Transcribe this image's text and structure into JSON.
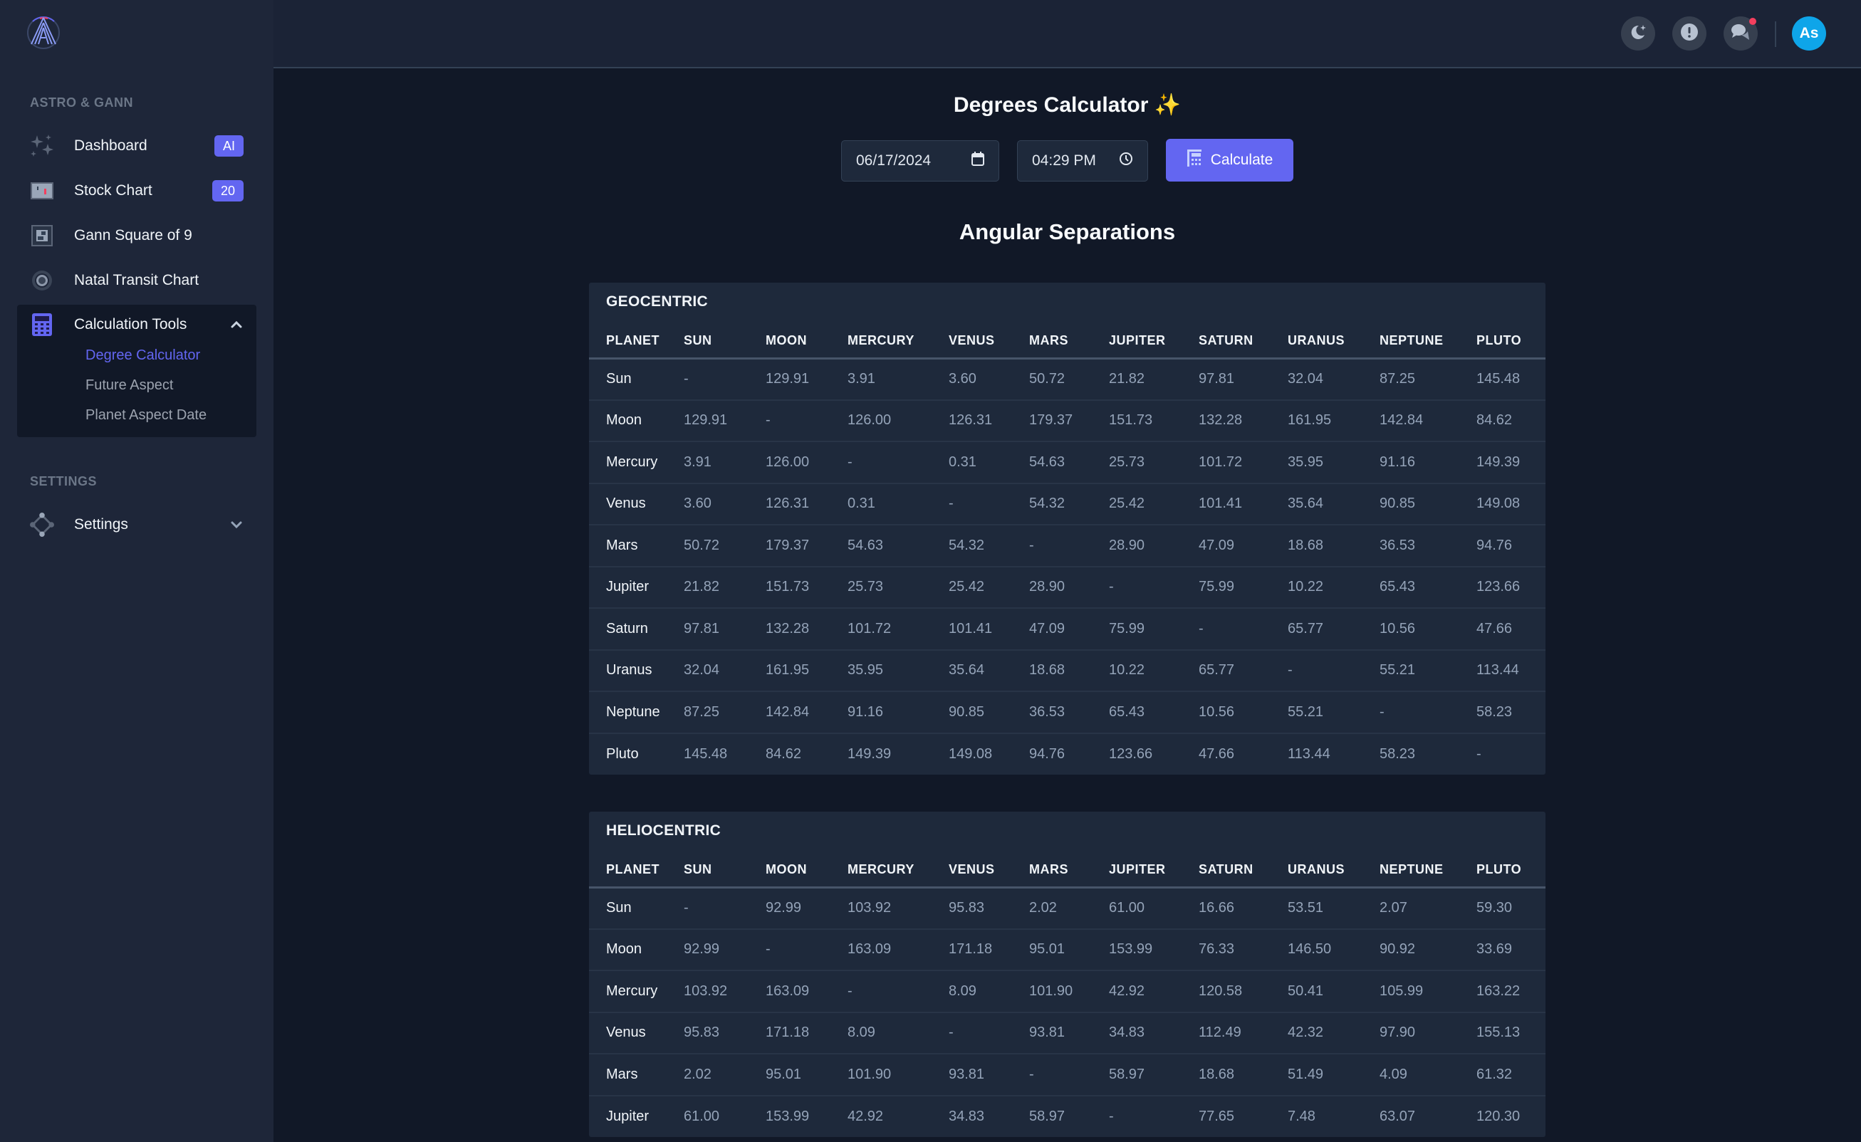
{
  "sidebar": {
    "logo_name": "astro-gann-logo",
    "sections": [
      {
        "label": "ASTRO & GANN"
      },
      {
        "label": "SETTINGS"
      }
    ],
    "items": [
      {
        "label": "Dashboard",
        "badge": "AI",
        "icon": "sparkles-icon"
      },
      {
        "label": "Stock Chart",
        "badge": "20",
        "icon": "stock-chart-icon"
      },
      {
        "label": "Gann Square of 9",
        "icon": "square-grid-icon"
      },
      {
        "label": "Natal Transit Chart",
        "icon": "target-circle-icon"
      },
      {
        "label": "Calculation Tools",
        "icon": "calculator-icon",
        "expanded": true,
        "children": [
          {
            "label": "Degree Calculator",
            "active": true
          },
          {
            "label": "Future Aspect"
          },
          {
            "label": "Planet Aspect Date"
          }
        ]
      }
    ],
    "settings": {
      "label": "Settings",
      "icon": "nodes-diamond-icon",
      "expanded": false
    }
  },
  "header": {
    "buttons": [
      "moon-theme-icon",
      "alert-icon",
      "chat-icon"
    ],
    "chat_has_notification": true,
    "avatar_initials": "As"
  },
  "main": {
    "title": "Degrees Calculator ✨",
    "date_value": "06/17/2024",
    "time_value": "04:29 PM",
    "calculate_label": "Calculate",
    "section_title": "Angular Separations",
    "columns": [
      "PLANET",
      "SUN",
      "MOON",
      "MERCURY",
      "VENUS",
      "MARS",
      "JUPITER",
      "SATURN",
      "URANUS",
      "NEPTUNE",
      "PLUTO"
    ],
    "tables": [
      {
        "title": "GEOCENTRIC",
        "rows": [
          [
            "Sun",
            "-",
            "129.91",
            "3.91",
            "3.60",
            "50.72",
            "21.82",
            "97.81",
            "32.04",
            "87.25",
            "145.48"
          ],
          [
            "Moon",
            "129.91",
            "-",
            "126.00",
            "126.31",
            "179.37",
            "151.73",
            "132.28",
            "161.95",
            "142.84",
            "84.62"
          ],
          [
            "Mercury",
            "3.91",
            "126.00",
            "-",
            "0.31",
            "54.63",
            "25.73",
            "101.72",
            "35.95",
            "91.16",
            "149.39"
          ],
          [
            "Venus",
            "3.60",
            "126.31",
            "0.31",
            "-",
            "54.32",
            "25.42",
            "101.41",
            "35.64",
            "90.85",
            "149.08"
          ],
          [
            "Mars",
            "50.72",
            "179.37",
            "54.63",
            "54.32",
            "-",
            "28.90",
            "47.09",
            "18.68",
            "36.53",
            "94.76"
          ],
          [
            "Jupiter",
            "21.82",
            "151.73",
            "25.73",
            "25.42",
            "28.90",
            "-",
            "75.99",
            "10.22",
            "65.43",
            "123.66"
          ],
          [
            "Saturn",
            "97.81",
            "132.28",
            "101.72",
            "101.41",
            "47.09",
            "75.99",
            "-",
            "65.77",
            "10.56",
            "47.66"
          ],
          [
            "Uranus",
            "32.04",
            "161.95",
            "35.95",
            "35.64",
            "18.68",
            "10.22",
            "65.77",
            "-",
            "55.21",
            "113.44"
          ],
          [
            "Neptune",
            "87.25",
            "142.84",
            "91.16",
            "90.85",
            "36.53",
            "65.43",
            "10.56",
            "55.21",
            "-",
            "58.23"
          ],
          [
            "Pluto",
            "145.48",
            "84.62",
            "149.39",
            "149.08",
            "94.76",
            "123.66",
            "47.66",
            "113.44",
            "58.23",
            "-"
          ]
        ]
      },
      {
        "title": "HELIOCENTRIC",
        "rows": [
          [
            "Sun",
            "-",
            "92.99",
            "103.92",
            "95.83",
            "2.02",
            "61.00",
            "16.66",
            "53.51",
            "2.07",
            "59.30"
          ],
          [
            "Moon",
            "92.99",
            "-",
            "163.09",
            "171.18",
            "95.01",
            "153.99",
            "76.33",
            "146.50",
            "90.92",
            "33.69"
          ],
          [
            "Mercury",
            "103.92",
            "163.09",
            "-",
            "8.09",
            "101.90",
            "42.92",
            "120.58",
            "50.41",
            "105.99",
            "163.22"
          ],
          [
            "Venus",
            "95.83",
            "171.18",
            "8.09",
            "-",
            "93.81",
            "34.83",
            "112.49",
            "42.32",
            "97.90",
            "155.13"
          ],
          [
            "Mars",
            "2.02",
            "95.01",
            "101.90",
            "93.81",
            "-",
            "58.97",
            "18.68",
            "51.49",
            "4.09",
            "61.32"
          ],
          [
            "Jupiter",
            "61.00",
            "153.99",
            "42.92",
            "34.83",
            "58.97",
            "-",
            "77.65",
            "7.48",
            "63.07",
            "120.30"
          ]
        ]
      }
    ]
  },
  "colors": {
    "accent": "#6366f1",
    "avatar": "#0ea5e9",
    "notification": "#f43f5e",
    "sidebar_bg": "#1e2639",
    "main_bg": "#111827",
    "card_bg": "#1e293b"
  }
}
